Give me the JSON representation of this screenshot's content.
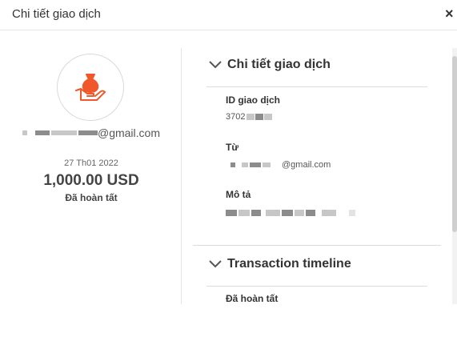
{
  "dialog": {
    "title": "Chi tiết giao dịch",
    "close_label": "×"
  },
  "summary": {
    "icon": "money-bag-hand-icon",
    "email_suffix": "@gmail.com",
    "date": "27 Th01 2022",
    "amount": "1,000.00 USD",
    "status": "Đã hoàn tất"
  },
  "details": {
    "section_title": "Chi tiết giao dịch",
    "id_label": "ID giao dịch",
    "id_value_prefix": "3702",
    "from_label": "Từ",
    "from_email_suffix": "@gmail.com",
    "description_label": "Mô tả"
  },
  "timeline": {
    "section_title": "Transaction timeline",
    "first_status": "Đã hoàn tất"
  },
  "colors": {
    "accent": "#f0582b"
  }
}
